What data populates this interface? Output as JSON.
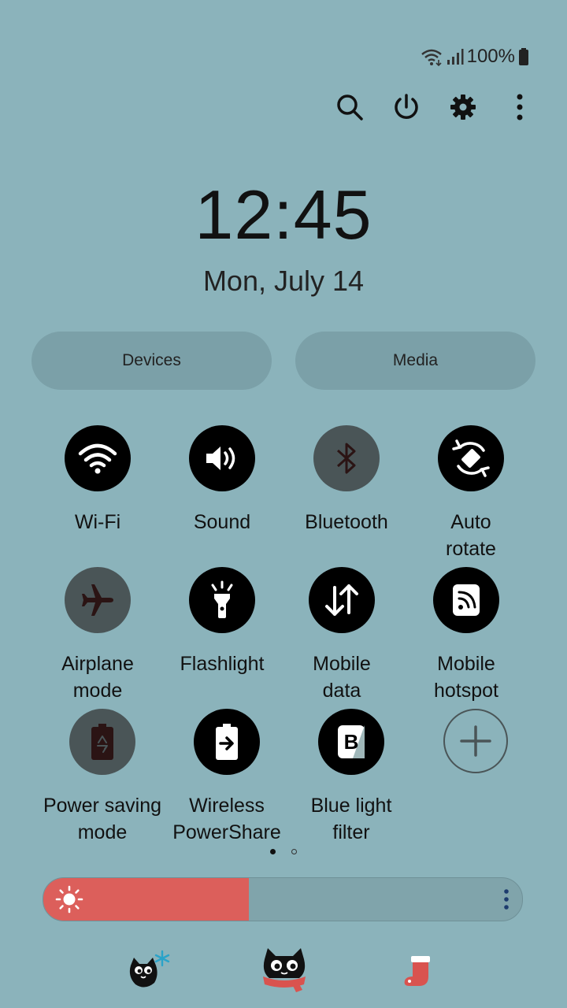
{
  "status": {
    "battery_text": "100%",
    "icons": [
      "wifi-icon",
      "signal-icon",
      "battery-icon"
    ]
  },
  "top_actions": [
    "search-icon",
    "power-icon",
    "settings-gear-icon",
    "more-vert-icon"
  ],
  "clock": {
    "time": "12:45",
    "date": "Mon, July 14"
  },
  "pills": {
    "devices": "Devices",
    "media": "Media"
  },
  "tiles": [
    {
      "label": "Wi-Fi",
      "icon": "wifi-icon",
      "state": "on"
    },
    {
      "label": "Sound",
      "icon": "volume-icon",
      "state": "on"
    },
    {
      "label": "Bluetooth",
      "icon": "bluetooth-icon",
      "state": "off"
    },
    {
      "label": "Auto\nrotate",
      "icon": "auto-rotate-icon",
      "state": "on"
    },
    {
      "label": "Airplane\nmode",
      "icon": "airplane-icon",
      "state": "off"
    },
    {
      "label": "Flashlight",
      "icon": "flashlight-icon",
      "state": "on"
    },
    {
      "label": "Mobile\ndata",
      "icon": "mobile-data-icon",
      "state": "on"
    },
    {
      "label": "Mobile\nhotspot",
      "icon": "hotspot-icon",
      "state": "on"
    },
    {
      "label": "Power saving\nmode",
      "icon": "power-saving-icon",
      "state": "off"
    },
    {
      "label": "Wireless\nPowerShare",
      "icon": "wireless-powershare-icon",
      "state": "on"
    },
    {
      "label": "Blue light\nfilter",
      "icon": "blue-light-filter-icon",
      "state": "on"
    },
    {
      "label": "",
      "icon": "add-icon",
      "state": "add"
    }
  ],
  "pager": {
    "pages": 2,
    "current": 1
  },
  "brightness": {
    "level": 0.43
  },
  "colors": {
    "background": "#8bb3bb",
    "pill": "#7ba0a8",
    "tile_on": "#000000",
    "tile_off": "#4a5557",
    "brightness_fill": "#dc5f5b",
    "icon_on": "#ffffff"
  },
  "stickers": [
    "cat-snowflake-sticker",
    "cat-scarf-sticker",
    "stocking-sticker"
  ]
}
